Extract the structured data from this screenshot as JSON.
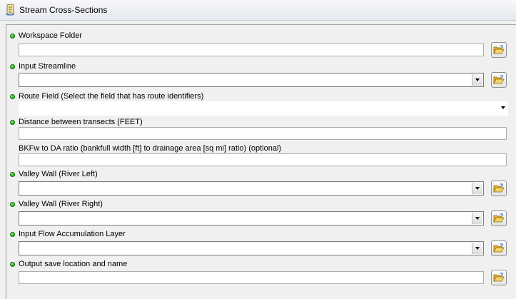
{
  "window": {
    "title": "Stream Cross-Sections"
  },
  "parameters": [
    {
      "label": "Workspace Folder",
      "required": true,
      "control": "text",
      "value": ""
    },
    {
      "label": "Input Streamline",
      "required": true,
      "control": "combo",
      "value": ""
    },
    {
      "label": "Route Field (Select the field that has route identifiers)",
      "required": true,
      "control": "dropdown",
      "value": ""
    },
    {
      "label": "Distance between transects (FEET)",
      "required": true,
      "control": "text",
      "value": ""
    },
    {
      "label": "BKFw to DA ratio (bankfull width [ft] to drainage area [sq mi] ratio) (optional)",
      "required": false,
      "control": "text",
      "value": ""
    },
    {
      "label": "Valley Wall (River Left)",
      "required": true,
      "control": "combo",
      "value": ""
    },
    {
      "label": "Valley Wall (River Right)",
      "required": true,
      "control": "combo",
      "value": ""
    },
    {
      "label": "Input Flow Accumulation Layer",
      "required": true,
      "control": "combo",
      "value": ""
    },
    {
      "label": "Output save location and name",
      "required": true,
      "control": "text",
      "value": ""
    }
  ],
  "icons": {
    "app": "toolbox-script-icon",
    "required": "green-dot-icon",
    "browse": "open-folder-icon"
  },
  "colors": {
    "required_dot": "#27c21c",
    "folder": "#f2c04a"
  }
}
